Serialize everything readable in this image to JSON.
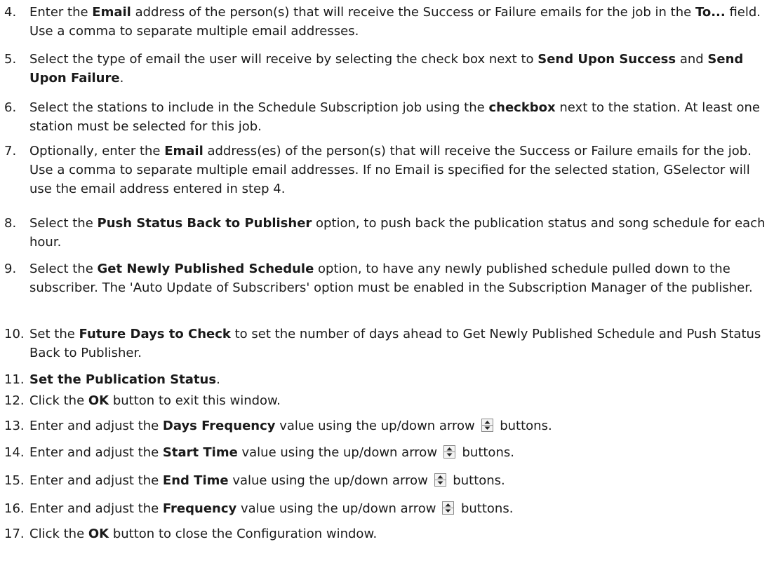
{
  "steps": [
    {
      "number": "4.",
      "parts": [
        {
          "t": "Enter the "
        },
        {
          "b": "Email"
        },
        {
          "t": " address of the person(s) that will receive the Success or Failure emails for the job in the "
        },
        {
          "b": "To..."
        },
        {
          "t": " field. Use a comma to separate multiple email addresses."
        }
      ]
    },
    {
      "number": "5.",
      "parts": [
        {
          "t": "Select the type of email the user will receive by selecting the check box next to "
        },
        {
          "b": "Send Upon Success"
        },
        {
          "t": " and "
        },
        {
          "b": "Send Upon Failure"
        },
        {
          "t": "."
        }
      ]
    },
    {
      "number": "6.",
      "parts": [
        {
          "t": "Select the stations to include in the Schedule Subscription job using the "
        },
        {
          "b": "checkbox"
        },
        {
          "t": " next to the station. At least one station must be selected for this job."
        }
      ]
    },
    {
      "number": "7.",
      "parts": [
        {
          "t": "Optionally, enter the "
        },
        {
          "b": "Email"
        },
        {
          "t": " address(es) of the person(s) that will receive the Success or Failure emails for the job. Use a comma to separate multiple email addresses. If no Email is specified for the selected station, GSelector will use the email address entered in step 4."
        }
      ]
    },
    {
      "number": "8.",
      "parts": [
        {
          "t": "Select the "
        },
        {
          "b": "Push Status Back to Publisher"
        },
        {
          "t": " option, to push back the publication status and song schedule for each hour."
        }
      ]
    },
    {
      "number": "9.",
      "parts": [
        {
          "t": "Select the "
        },
        {
          "b": "Get Newly Published Schedule"
        },
        {
          "t": " option, to have any newly published schedule pulled down to the subscriber. The 'Auto Update of Subscribers' option must be enabled in the Subscription Manager of the publisher."
        }
      ]
    },
    {
      "number": "10.",
      "parts": [
        {
          "t": "Set the "
        },
        {
          "b": "Future Days to Check"
        },
        {
          "t": " to set the number of days ahead to Get Newly Published Schedule and Push Status Back to Publisher."
        }
      ]
    },
    {
      "number": "11.",
      "parts": [
        {
          "b": "Set the Publication Status"
        },
        {
          "t": "."
        }
      ]
    },
    {
      "number": "12.",
      "parts": [
        {
          "t": "Click the "
        },
        {
          "b": "OK"
        },
        {
          "t": " button to exit this window."
        }
      ]
    },
    {
      "number": "13.",
      "parts": [
        {
          "t": "Enter and adjust the "
        },
        {
          "b": "Days Frequency"
        },
        {
          "t": " value using the up/down arrow "
        },
        {
          "icon": "spinner-updown-icon"
        },
        {
          "t": " buttons."
        }
      ]
    },
    {
      "number": "14.",
      "parts": [
        {
          "t": "Enter and adjust the "
        },
        {
          "b": "Start Time"
        },
        {
          "t": " value using the up/down arrow "
        },
        {
          "icon": "spinner-updown-icon"
        },
        {
          "t": " buttons."
        }
      ]
    },
    {
      "number": "15.",
      "parts": [
        {
          "t": "Enter and adjust the "
        },
        {
          "b": "End Time"
        },
        {
          "t": " value using the up/down arrow "
        },
        {
          "icon": "spinner-updown-icon"
        },
        {
          "t": " buttons."
        }
      ]
    },
    {
      "number": "16.",
      "parts": [
        {
          "t": "Enter and adjust the "
        },
        {
          "b": "Frequency"
        },
        {
          "t": " value using the up/down arrow "
        },
        {
          "icon": "spinner-updown-icon"
        },
        {
          "t": " buttons."
        }
      ]
    },
    {
      "number": "17.",
      "parts": [
        {
          "t": "Click the "
        },
        {
          "b": "OK"
        },
        {
          "t": " button to close the Configuration window."
        }
      ]
    }
  ]
}
